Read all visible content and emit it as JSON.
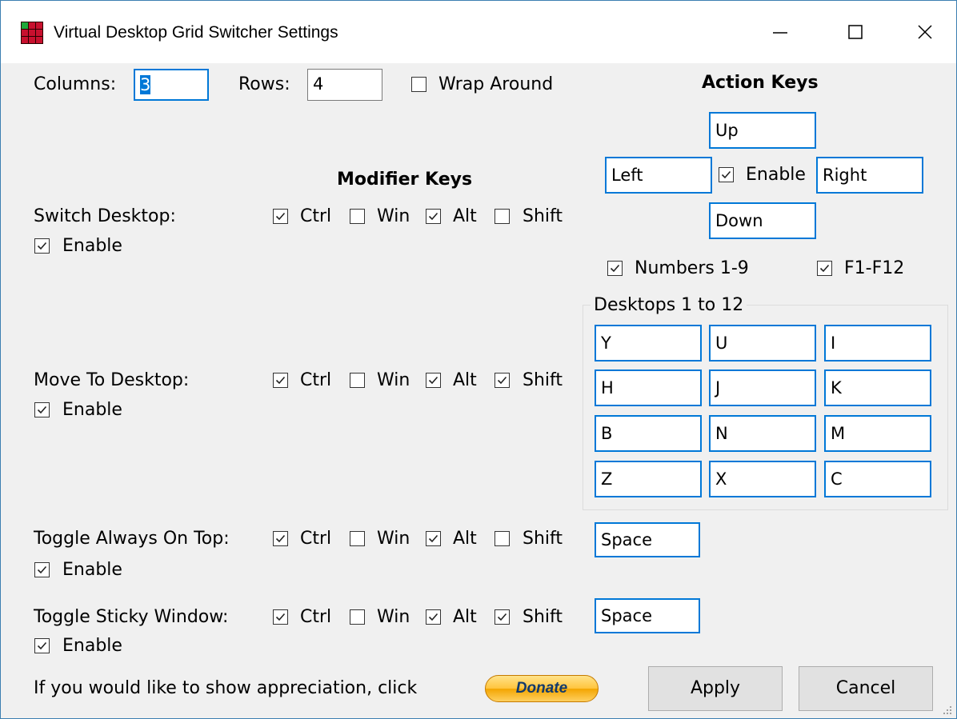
{
  "window": {
    "title": "Virtual Desktop Grid Switcher Settings",
    "app_icon": "grid-app-icon",
    "controls": {
      "minimize": "minimize-icon",
      "maximize": "maximize-icon",
      "close": "close-icon"
    }
  },
  "grid": {
    "columns_label": "Columns:",
    "columns_value": "3",
    "rows_label": "Rows:",
    "rows_value": "4",
    "wrap_label": "Wrap Around",
    "wrap_checked": false
  },
  "modifier_header": "Modifier Keys",
  "action_header": "Action Keys",
  "modifiers": {
    "ctrl": "Ctrl",
    "win": "Win",
    "alt": "Alt",
    "shift": "Shift"
  },
  "enable_label": "Enable",
  "sections": [
    {
      "label": "Switch Desktop:",
      "enabled": true,
      "ctrl": true,
      "win": false,
      "alt": true,
      "shift": false
    },
    {
      "label": "Move To Desktop:",
      "enabled": true,
      "ctrl": true,
      "win": false,
      "alt": true,
      "shift": true
    },
    {
      "label": "Toggle Always On Top:",
      "enabled": true,
      "ctrl": true,
      "win": false,
      "alt": true,
      "shift": false,
      "key": "Space"
    },
    {
      "label": "Toggle Sticky Window:",
      "enabled": true,
      "ctrl": true,
      "win": false,
      "alt": true,
      "shift": true,
      "key": "Space"
    }
  ],
  "arrows": {
    "up": "Up",
    "left": "Left",
    "right": "Right",
    "down": "Down",
    "enable_label": "Enable",
    "enable_checked": true
  },
  "numbers_label": "Numbers 1-9",
  "numbers_checked": true,
  "fkeys_label": "F1-F12",
  "fkeys_checked": true,
  "desktops_group_label": "Desktops 1 to 12",
  "desktop_keys": [
    "Y",
    "U",
    "I",
    "H",
    "J",
    "K",
    "B",
    "N",
    "M",
    "Z",
    "X",
    "C"
  ],
  "footer": {
    "appreciation_text": "If you would like to show appreciation, click",
    "donate_label": "Donate",
    "apply_label": "Apply",
    "cancel_label": "Cancel"
  }
}
